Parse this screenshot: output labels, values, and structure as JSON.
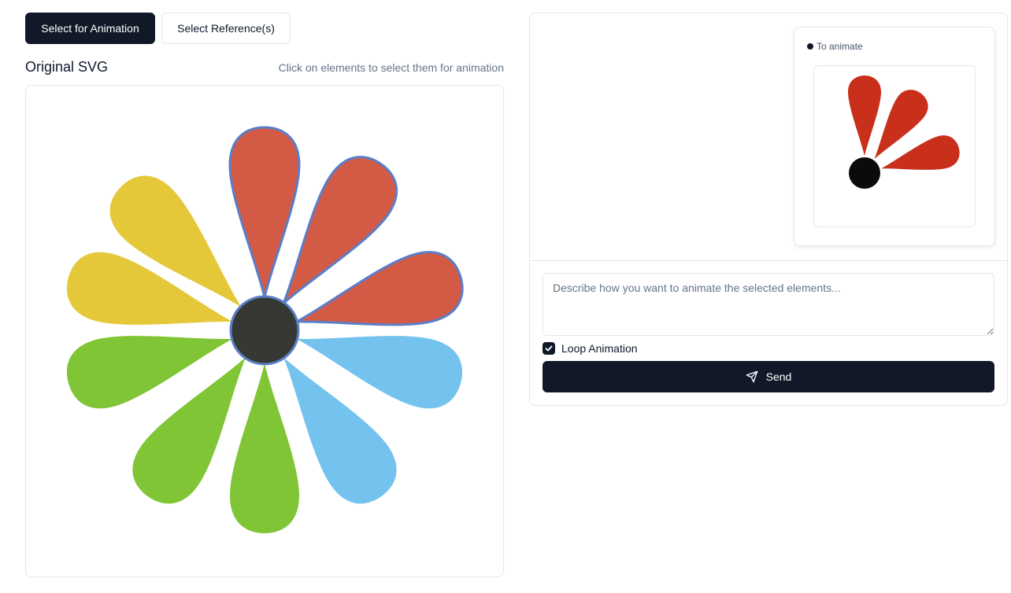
{
  "toolbar": {
    "select_animation_label": "Select for Animation",
    "select_reference_label": "Select Reference(s)"
  },
  "main": {
    "title": "Original SVG",
    "hint": "Click on elements to select them for animation"
  },
  "reference_card": {
    "label": "To animate"
  },
  "prompt": {
    "placeholder": "Describe how you want to animate the selected elements...",
    "value": ""
  },
  "loop": {
    "label": "Loop Animation",
    "checked": true
  },
  "send": {
    "label": "Send"
  },
  "colors": {
    "red_petal": "#d35a45",
    "yellow_petal": "#e5c83a",
    "green_petal": "#80c536",
    "blue_petal": "#74c3ee",
    "center": "#363833",
    "selection_outline": "#5b7ec7",
    "preview_red": "#c8301b",
    "preview_center": "#0b0c09"
  },
  "icons": {
    "send": "send-icon",
    "check": "check-icon"
  }
}
